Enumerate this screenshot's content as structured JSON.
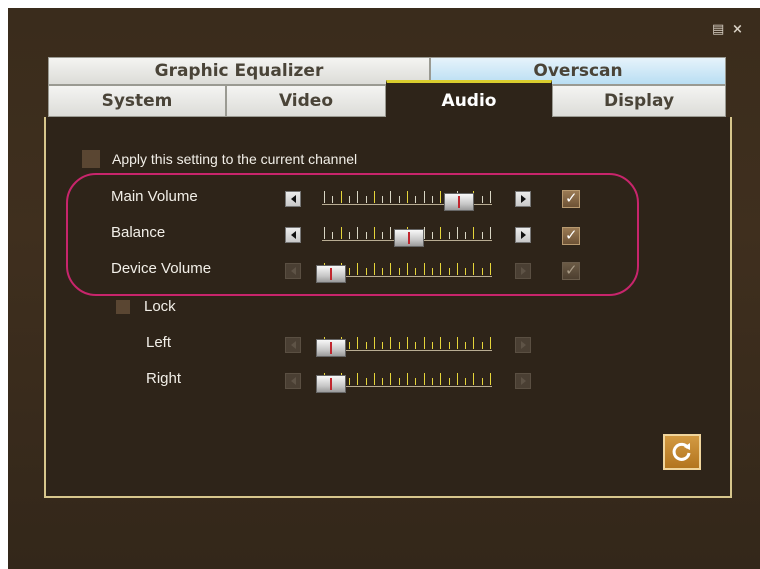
{
  "window": {
    "menu_icon": "menu-icon",
    "close_icon": "close-icon",
    "close_glyph": "×",
    "menu_glyph": "▤"
  },
  "tabs": {
    "row1": [
      {
        "label": "Graphic Equalizer"
      },
      {
        "label": "Overscan"
      }
    ],
    "row2": [
      {
        "label": "System"
      },
      {
        "label": "Video"
      },
      {
        "label": "Audio",
        "active": true
      },
      {
        "label": "Display"
      }
    ]
  },
  "audio": {
    "apply_label": "Apply this setting to the current channel",
    "rows": [
      {
        "label": "Main Volume",
        "level": 0.9,
        "checked": true
      },
      {
        "label": "Balance",
        "level": 0.55,
        "checked": true
      },
      {
        "label": "Device Volume",
        "level": 0.0,
        "checked": true
      },
      {
        "label": "Left",
        "level": 0.0
      },
      {
        "label": "Right",
        "level": 0.0
      }
    ],
    "lock_label": "Lock"
  },
  "colors": {
    "accent": "#d9cd2e",
    "panel": "#2e2419",
    "highlight": "#c8256c"
  },
  "reset_icon": "refresh-icon"
}
